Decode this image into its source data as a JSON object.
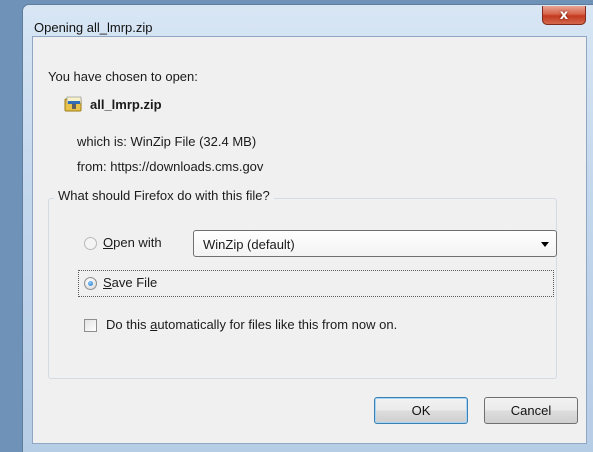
{
  "window": {
    "title": "Opening all_lmrp.zip",
    "close_label": "x"
  },
  "dialog": {
    "heading": "You have chosen to open:",
    "file_name": "all_lmrp.zip",
    "which_is": "which is:  WinZip File (32.4 MB)",
    "from": "from:  https://downloads.cms.gov"
  },
  "action_group": {
    "legend": "What should Firefox do with this file?",
    "open_with": {
      "label_prefix": "",
      "label_accel": "O",
      "label_rest": "pen with",
      "selected": false,
      "app_value": "WinZip (default)"
    },
    "save_file": {
      "label_accel": "S",
      "label_rest": "ave File",
      "selected": true
    },
    "auto": {
      "label_prefix": "Do this ",
      "label_accel": "a",
      "label_rest": "utomatically for files like this from now on.",
      "checked": false
    }
  },
  "buttons": {
    "ok": "OK",
    "cancel": "Cancel"
  },
  "icons": {
    "file": "winzip-file-icon",
    "dropdown": "chevron-down-icon"
  }
}
